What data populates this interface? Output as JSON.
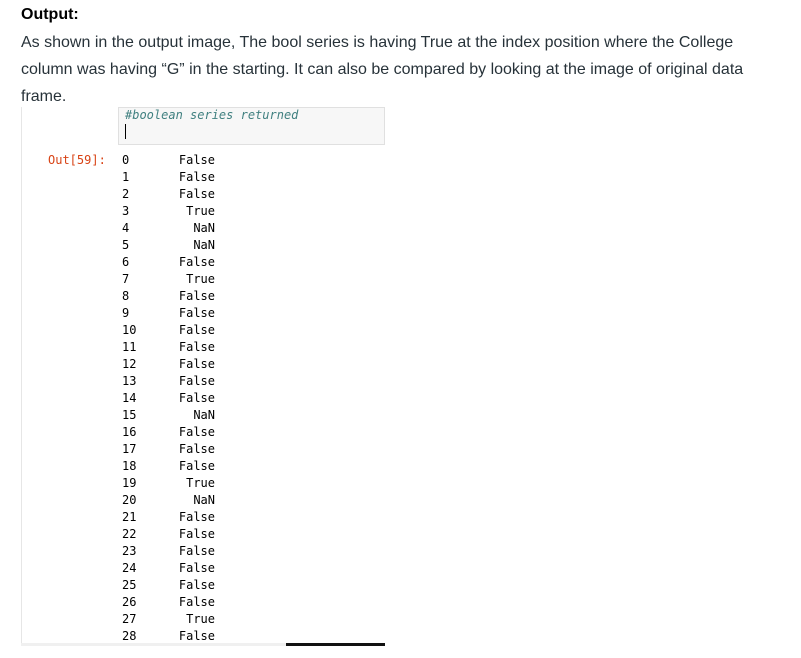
{
  "article": {
    "heading": "Output:",
    "paragraph": "As shown in the output image, The bool series is having True at the index position where the College column was having “G” in the starting. It can also be compared by looking at the image of original data frame."
  },
  "notebook": {
    "input_comment": "#boolean series returned",
    "output_prompt": "Out[59]:",
    "series": [
      {
        "index": "0",
        "value": "False"
      },
      {
        "index": "1",
        "value": "False"
      },
      {
        "index": "2",
        "value": "False"
      },
      {
        "index": "3",
        "value": "True"
      },
      {
        "index": "4",
        "value": "NaN"
      },
      {
        "index": "5",
        "value": "NaN"
      },
      {
        "index": "6",
        "value": "False"
      },
      {
        "index": "7",
        "value": "True"
      },
      {
        "index": "8",
        "value": "False"
      },
      {
        "index": "9",
        "value": "False"
      },
      {
        "index": "10",
        "value": "False"
      },
      {
        "index": "11",
        "value": "False"
      },
      {
        "index": "12",
        "value": "False"
      },
      {
        "index": "13",
        "value": "False"
      },
      {
        "index": "14",
        "value": "False"
      },
      {
        "index": "15",
        "value": "NaN"
      },
      {
        "index": "16",
        "value": "False"
      },
      {
        "index": "17",
        "value": "False"
      },
      {
        "index": "18",
        "value": "False"
      },
      {
        "index": "19",
        "value": "True"
      },
      {
        "index": "20",
        "value": "NaN"
      },
      {
        "index": "21",
        "value": "False"
      },
      {
        "index": "22",
        "value": "False"
      },
      {
        "index": "23",
        "value": "False"
      },
      {
        "index": "24",
        "value": "False"
      },
      {
        "index": "25",
        "value": "False"
      },
      {
        "index": "26",
        "value": "False"
      },
      {
        "index": "27",
        "value": "True"
      },
      {
        "index": "28",
        "value": "False"
      }
    ]
  },
  "colors": {
    "out_prompt": "#d84315",
    "comment": "#408080",
    "text": "#273239"
  }
}
